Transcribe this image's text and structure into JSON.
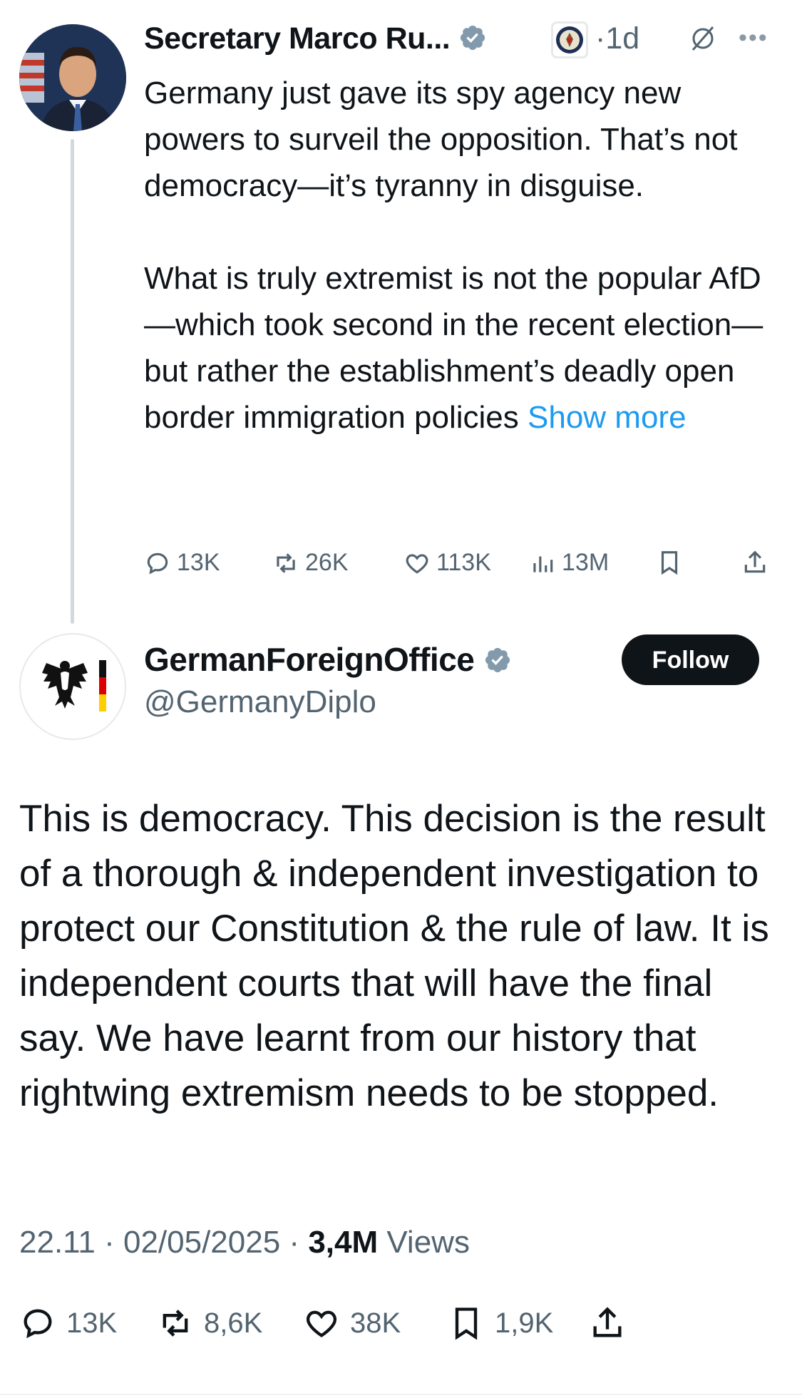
{
  "parent": {
    "author_name": "Secretary Marco Ru...",
    "age": "1d",
    "text_paragraphs": [
      "Germany just gave its spy agency new powers to surveil the opposition. That’s not democracy—it’s tyranny in disguise.",
      "What is truly extremist is not the popular AfD—which took second in the recent election—but rather the establishment’s deadly open border immigration policies"
    ],
    "show_more": "Show more",
    "actions": {
      "replies": "13K",
      "reposts": "26K",
      "likes": "113K",
      "views": "13M"
    }
  },
  "reply": {
    "author_name": "GermanForeignOffice",
    "handle": "@GermanyDiplo",
    "follow_label": "Follow",
    "text": "This is democracy. This decision is the result of a thorough & independent investigation to protect our Constitution & the rule of law. It is independent courts that will have the final say. We have learnt from our history that rightwing extremism needs to be stopped.",
    "time": "22.11",
    "date": "02/05/2025",
    "views_count": "3,4M",
    "views_label": "Views",
    "actions": {
      "replies": "13K",
      "reposts": "8,6K",
      "likes": "38K",
      "bookmarks": "1,9K"
    }
  },
  "colors": {
    "text": "#0f1419",
    "secondary": "#536471",
    "link": "#1d9bf0",
    "verified_gray": "#829aab",
    "follow_bg": "#0f1419"
  },
  "icons": [
    "verified-badge-icon",
    "state-department-seal-icon",
    "grok-icon",
    "more-icon",
    "reply-icon",
    "repost-icon",
    "like-icon",
    "views-icon",
    "bookmark-icon",
    "share-icon",
    "german-eagle-logo"
  ]
}
